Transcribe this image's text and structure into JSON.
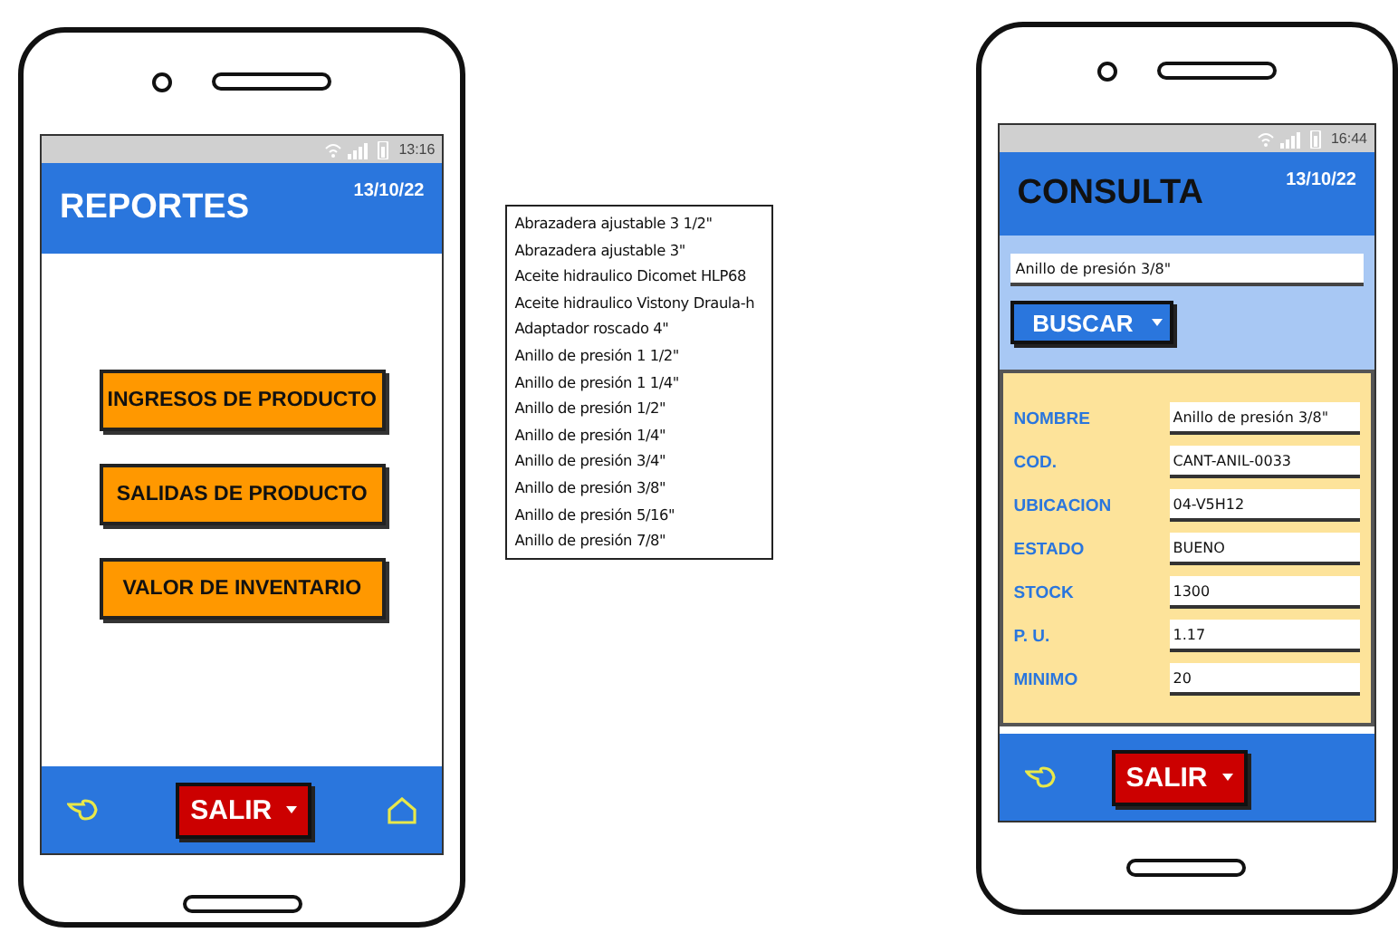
{
  "reportes_screen": {
    "status_time": "13:16",
    "title": "REPORTES",
    "date": "13/10/22",
    "menu_buttons": [
      "INGRESOS DE PRODUCTO",
      "SALIDAS DE PRODUCTO",
      "VALOR DE INVENTARIO"
    ],
    "exit_button": "SALIR"
  },
  "product_list": [
    "Abrazadera ajustable 3 1/2\"",
    "Abrazadera ajustable 3\"",
    "Aceite hidraulico Dicomet HLP68",
    "Aceite hidraulico Vistony Draula-h",
    "Adaptador roscado 4\"",
    "Anillo de presión 1 1/2\"",
    "Anillo de presión 1 1/4\"",
    "Anillo de presión 1/2\"",
    "Anillo de presión 1/4\"",
    "Anillo de presión 3/4\"",
    "Anillo de presión 3/8\"",
    "Anillo de presión 5/16\"",
    "Anillo de presión 7/8\""
  ],
  "consulta_screen": {
    "status_time": "16:44",
    "title": "CONSULTA",
    "date": "13/10/22",
    "search": {
      "value": "Anillo de presión 3/8\""
    },
    "search_button": "BUSCAR",
    "fields": [
      {
        "label": "NOMBRE",
        "value": "Anillo de presión 3/8\""
      },
      {
        "label": "COD.",
        "value": "CANT-ANIL-0033"
      },
      {
        "label": "UBICACION",
        "value": "04-V5H12"
      },
      {
        "label": "ESTADO",
        "value": "BUENO"
      },
      {
        "label": "STOCK",
        "value": "1300"
      },
      {
        "label": "P. U.",
        "value": "1.17"
      },
      {
        "label": "MINIMO",
        "value": "20"
      }
    ],
    "exit_button": "SALIR"
  }
}
